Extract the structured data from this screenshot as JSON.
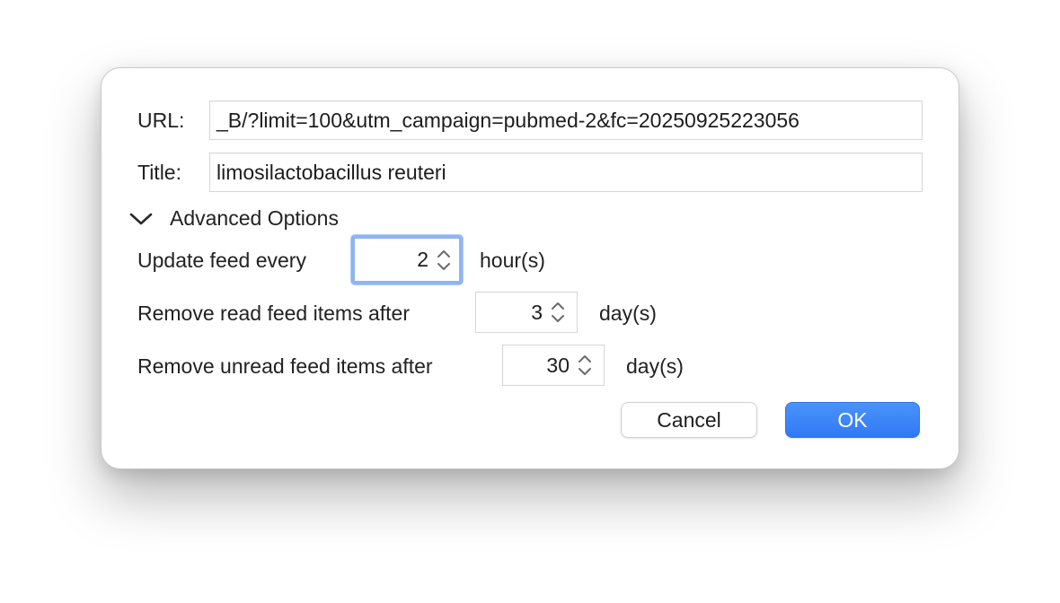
{
  "dialog": {
    "url_label": "URL:",
    "url_value": "_B/?limit=100&utm_campaign=pubmed-2&fc=20250925223056",
    "title_label": "Title:",
    "title_value": "limosilactobacillus reuteri",
    "advanced_label": "Advanced Options",
    "advanced_icon": "chevron-down-icon",
    "update": {
      "label": "Update feed every",
      "value": "2",
      "unit": "hour(s)"
    },
    "remove_read": {
      "label": "Remove read feed items after",
      "value": "3",
      "unit": "day(s)"
    },
    "remove_unread": {
      "label": "Remove unread feed items after",
      "value": "30",
      "unit": "day(s)"
    },
    "cancel_label": "Cancel",
    "ok_label": "OK"
  },
  "colors": {
    "accent": "#3179f5",
    "focus_ring": "#8eb4f3"
  }
}
